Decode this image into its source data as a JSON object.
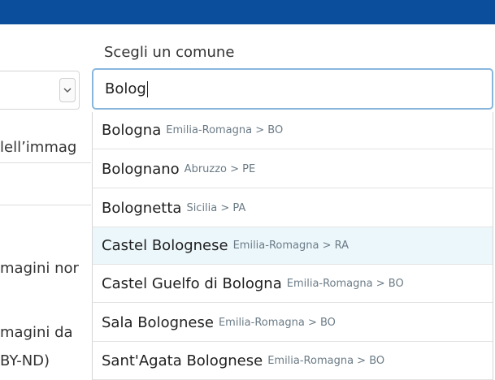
{
  "left_panel": {
    "line1": "lell’immag",
    "line2": "magini nor",
    "line3": "magini da",
    "line4": "BY-ND)"
  },
  "comune": {
    "label": "Scegli un comune",
    "value": "Bolog"
  },
  "suggestions": [
    {
      "city": "Bologna",
      "region": "Emilia-Romagna > BO"
    },
    {
      "city": "Bolognano",
      "region": "Abruzzo > PE"
    },
    {
      "city": "Bolognetta",
      "region": "Sicilia > PA"
    },
    {
      "city": "Castel Bolognese",
      "region": "Emilia-Romagna > RA"
    },
    {
      "city": "Castel Guelfo di Bologna",
      "region": "Emilia-Romagna > BO"
    },
    {
      "city": "Sala Bolognese",
      "region": "Emilia-Romagna > BO"
    },
    {
      "city": "Sant'Agata Bolognese",
      "region": "Emilia-Romagna > BO"
    }
  ],
  "highlighted_index": 3,
  "colors": {
    "topbar": "#0b4e9b",
    "highlight": "#ecf7fb",
    "focus_border": "#8ab6dd"
  }
}
